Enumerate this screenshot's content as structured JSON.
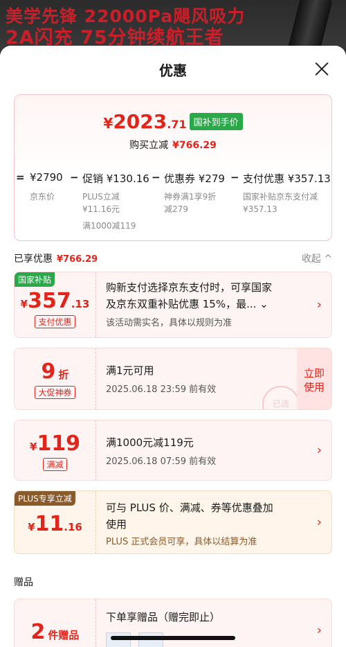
{
  "banner": {
    "line1": "美学先锋 22000Pa飓风吸力",
    "line2": "2A闪充 75分钟续航王者"
  },
  "sheet": {
    "title": "优惠"
  },
  "summary": {
    "yen": "¥",
    "price_int": "2023",
    "price_dec": ".71",
    "badge": "国补到手价",
    "instant_label": "购买立减",
    "instant_amount": "¥766.29",
    "calc": {
      "eq": "=",
      "jd_price": "¥2790",
      "jd_label": "京东价",
      "minus": "−",
      "promo": "促销 ¥130.16",
      "promo_sub1": "PLUS立减",
      "promo_sub2": "¥11.16元",
      "promo_sub3": "满1000减119",
      "coupon": "优惠券 ¥279",
      "coupon_sub1": "神券满1享9折",
      "coupon_sub2": "减279",
      "pay": "支付优惠 ¥357.13",
      "pay_sub1": "国家补贴京东支付减",
      "pay_sub2": "¥357.13"
    }
  },
  "enjoyed": {
    "label": "已享优惠",
    "amount": "¥766.29",
    "collapse": "收起 ^"
  },
  "cards": [
    {
      "corner": "国家补贴",
      "yen": "¥",
      "int": "357",
      "dec": ".13",
      "tag": "支付优惠",
      "line1": "购新支付选择京东支付时，可享国家",
      "line2": "及京东双重补贴优惠 15%，最... ⌄",
      "sub": "该活动需实名，具体以规则为准",
      "arrow": "›"
    },
    {
      "int": "9",
      "unit": "折",
      "tag": "大促神券",
      "line1": "满1元可用",
      "sub": "2025.06.18 23:59 前有效",
      "side1": "立即",
      "side2": "使用",
      "stamp": "已选"
    },
    {
      "yen": "¥",
      "int": "119",
      "tag": "满减",
      "line1": "满1000元减119元",
      "sub": "2025.06.18 07:59 前有效",
      "arrow": "›"
    },
    {
      "corner": "PLUS专享立减",
      "yen": "¥",
      "int": "11",
      "dec": ".16",
      "line1": "可与 PLUS 价、满减、券等优惠叠加",
      "line2": "使用",
      "sub": "PLUS 正式会员可享，具体以结算为准",
      "arrow": "›"
    }
  ],
  "gifts": {
    "label": "赠品",
    "count": "2",
    "unit": "件赠品",
    "line1": "下单享赠品（赠完即止）",
    "arrow": "›"
  },
  "colors": {
    "accent": "#e1251b",
    "gov_green": "#2aa84a",
    "plus_brown": "#8b5a2b"
  }
}
